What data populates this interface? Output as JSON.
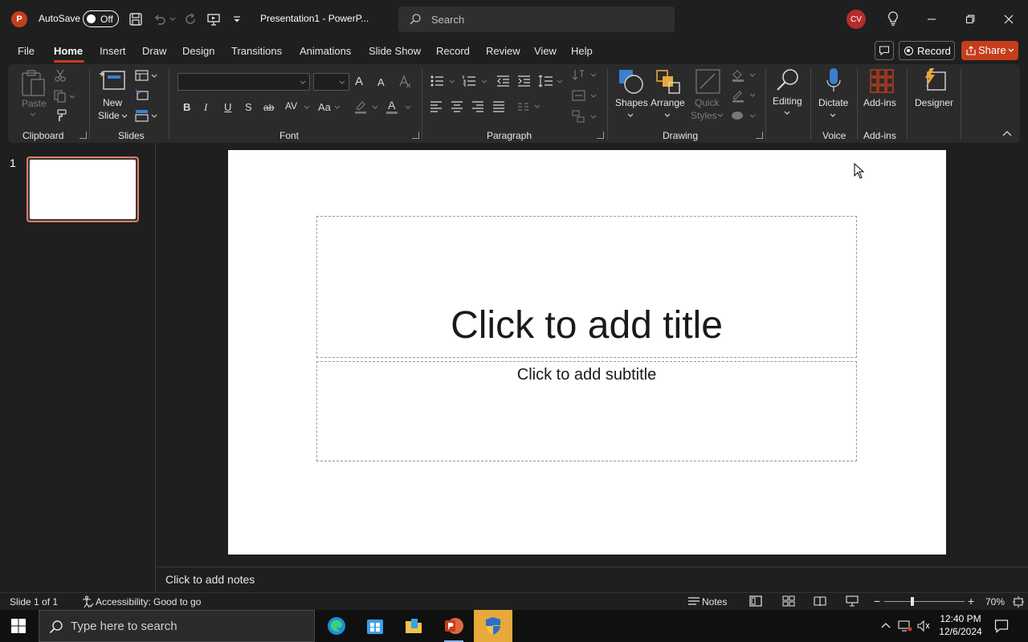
{
  "titlebar": {
    "app_logo": "P",
    "autosave_label": "AutoSave",
    "autosave_state": "Off",
    "doc_title": "Presentation1 - PowerP...",
    "search_placeholder": "Search",
    "user_initials": "CV",
    "icons": [
      "save-icon",
      "undo-icon",
      "redo-icon",
      "present-icon",
      "customize-qat-icon",
      "lightbulb-icon",
      "minimize-icon",
      "restore-icon",
      "close-icon"
    ]
  },
  "tabs": {
    "items": [
      "File",
      "Home",
      "Insert",
      "Draw",
      "Design",
      "Transitions",
      "Animations",
      "Slide Show",
      "Record",
      "Review",
      "View",
      "Help"
    ],
    "active": "Home",
    "record_label": "Record",
    "share_label": "Share"
  },
  "ribbon": {
    "clipboard": {
      "label": "Clipboard",
      "paste": "Paste"
    },
    "slides": {
      "label": "Slides",
      "new_slide": [
        "New",
        "Slide"
      ]
    },
    "font": {
      "label": "Font",
      "bold": "B",
      "italic": "I",
      "underline": "U",
      "shadow": "S",
      "strikethrough": "ab",
      "spacing": "AV",
      "case": "Aa",
      "grow": "A",
      "shrink": "A",
      "font_color": "A"
    },
    "paragraph": {
      "label": "Paragraph"
    },
    "drawing": {
      "label": "Drawing",
      "shapes": "Shapes",
      "arrange": "Arrange",
      "quick_styles": [
        "Quick",
        "Styles"
      ]
    },
    "editing": {
      "label": "Editing"
    },
    "voice": {
      "label": "Voice",
      "dictate": "Dictate"
    },
    "addins": {
      "label": "Add-ins",
      "addins_btn": "Add-ins"
    },
    "designer": {
      "label": "Designer"
    }
  },
  "thumbnails": {
    "number": "1"
  },
  "slide": {
    "title_placeholder": "Click to add title",
    "subtitle_placeholder": "Click to add subtitle"
  },
  "notes": {
    "placeholder": "Click to add notes"
  },
  "statusbar": {
    "slide_count": "Slide 1 of 1",
    "accessibility": "Accessibility: Good to go",
    "notes": "Notes",
    "zoom_out": "−",
    "zoom_in": "+",
    "zoom": "70%",
    "zoom_fraction": 0.35
  },
  "taskbar": {
    "search_placeholder": "Type here to search",
    "time": "12:40 PM",
    "date": "12/6/2024",
    "colors": {
      "active_app_bg": "#e6a93a",
      "accent": "#c43e1c"
    }
  }
}
